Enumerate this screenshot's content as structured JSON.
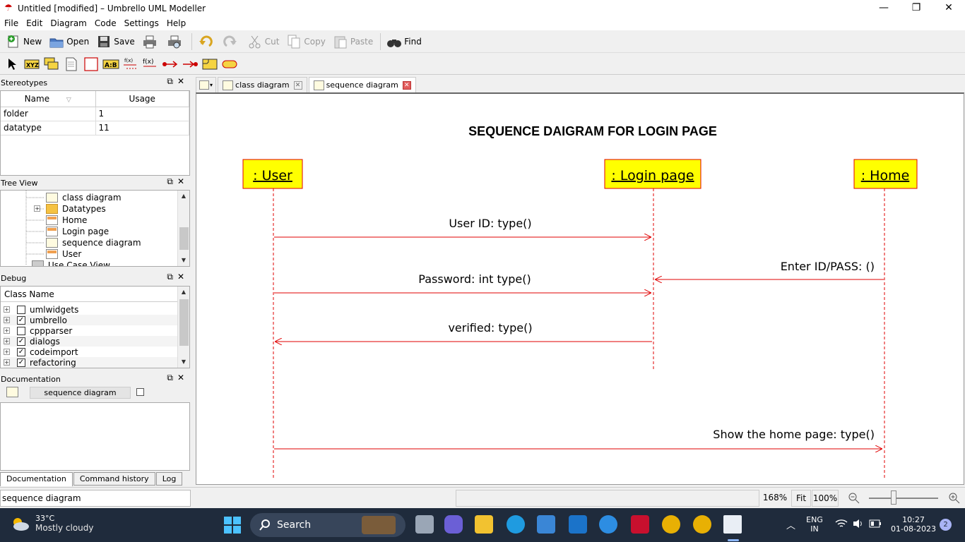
{
  "window": {
    "title": "Untitled [modified] – Umbrello UML Modeller",
    "minimize": "—",
    "restore": "❐",
    "close": "✕"
  },
  "menu": [
    "File",
    "Edit",
    "Diagram",
    "Code",
    "Settings",
    "Help"
  ],
  "toolbar": {
    "new": "New",
    "open": "Open",
    "save": "Save",
    "cut": "Cut",
    "copy": "Copy",
    "paste": "Paste",
    "find": "Find"
  },
  "stereotypes": {
    "title": "Stereotypes",
    "columns": [
      "Name",
      "Usage"
    ],
    "rows": [
      {
        "name": "folder",
        "usage": "1"
      },
      {
        "name": "datatype",
        "usage": "11"
      }
    ]
  },
  "tree_view": {
    "title": "Tree View",
    "items": [
      "class diagram",
      "Datatypes",
      "Home",
      "Login page",
      "sequence diagram",
      "User",
      "Use Case View"
    ]
  },
  "debug": {
    "title": "Debug",
    "column": "Class Name",
    "rows": [
      {
        "name": "umlwidgets",
        "checked": false
      },
      {
        "name": "umbrello",
        "checked": true
      },
      {
        "name": "cppparser",
        "checked": false
      },
      {
        "name": "dialogs",
        "checked": true
      },
      {
        "name": "codeimport",
        "checked": true
      },
      {
        "name": "refactoring",
        "checked": true
      }
    ]
  },
  "documentation": {
    "title": "Documentation",
    "name_field": "sequence diagram",
    "tabs": [
      "Documentation",
      "Command history",
      "Log"
    ]
  },
  "diagram_tabs": [
    "class diagram",
    "sequence diagram"
  ],
  "diagram": {
    "title": "SEQUENCE DAIGRAM FOR LOGIN PAGE",
    "objects": [
      ": User",
      ": Login page",
      ": Home"
    ],
    "messages": [
      "User ID: type()",
      "Enter ID/PASS: ()",
      "Password: int type()",
      "verified: type()",
      "Show the home page: type()"
    ],
    "object_fill": "#ffff00",
    "object_border": "#e00000",
    "message_color": "#e00000"
  },
  "status": {
    "text": "sequence diagram",
    "zoom": "168%",
    "fit": "Fit",
    "hundred": "100%"
  },
  "taskbar": {
    "temperature": "33°C",
    "weather": "Mostly cloudy",
    "search": "Search",
    "lang1": "ENG",
    "lang2": "IN",
    "time": "10:27",
    "date": "01-08-2023",
    "notif": "2"
  }
}
